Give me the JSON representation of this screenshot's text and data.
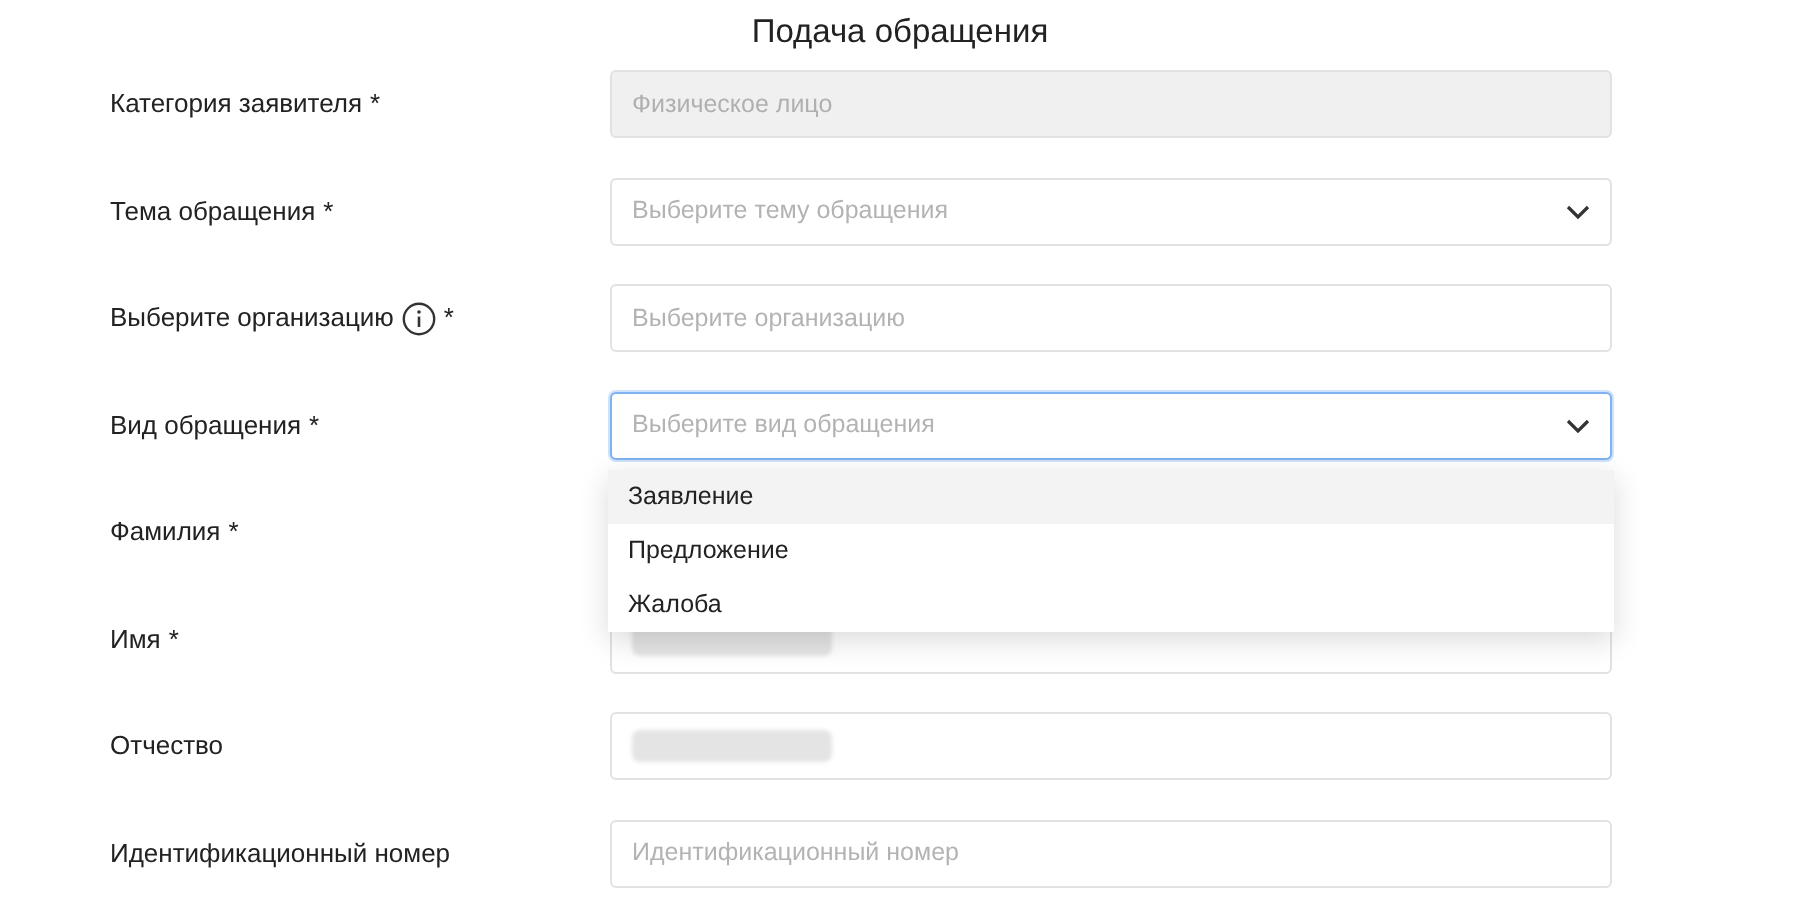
{
  "title": "Подача обращения",
  "fields": [
    {
      "label": "Категория заявителя",
      "mark": "*",
      "kind": "input",
      "value": "Физическое лицо",
      "disabled": true
    },
    {
      "label": "Тема обращения",
      "mark": "*",
      "kind": "select",
      "placeholder": "Выберите тему обращения"
    },
    {
      "label": "Выберите организацию",
      "mark": "*",
      "info": true,
      "kind": "input",
      "placeholder": "Выберите организацию"
    },
    {
      "label": "Вид обращения",
      "mark": "*",
      "kind": "select",
      "placeholder": "Выберите вид обращения",
      "focused": true,
      "options": [
        {
          "label": "Заявление",
          "highlighted": true
        },
        {
          "label": "Предложение",
          "highlighted": false
        },
        {
          "label": "Жалоба",
          "highlighted": false
        }
      ]
    },
    {
      "label": "Фамилия",
      "mark": "*"
    },
    {
      "label": "Имя",
      "mark": "*",
      "kind": "input",
      "redacted": true
    },
    {
      "label": "Отчество",
      "kind": "input",
      "redacted": true
    },
    {
      "label": "Идентификационный номер",
      "kind": "input",
      "placeholder": "Идентификационный номер"
    }
  ]
}
